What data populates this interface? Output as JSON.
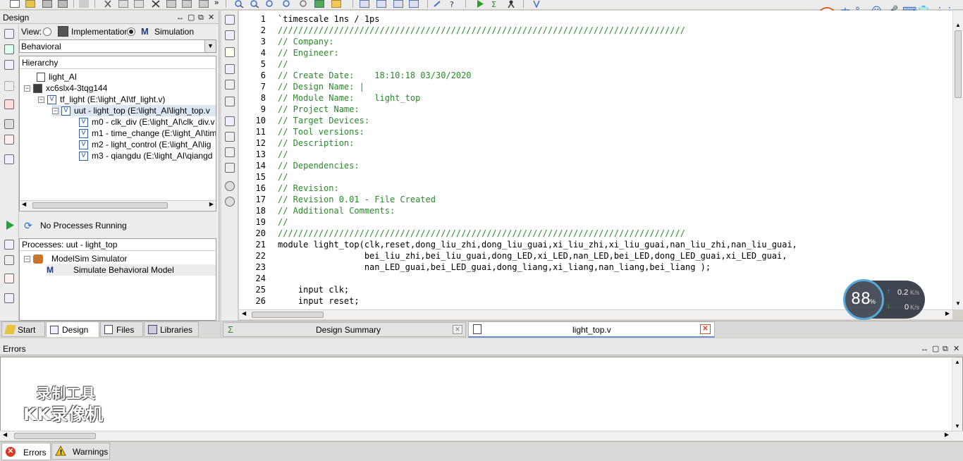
{
  "design_panel": {
    "title": "Design",
    "view_label": "View:",
    "view_options": [
      "Implementation",
      "Simulation"
    ],
    "view_selected": "Simulation",
    "behavior_select": "Behavioral",
    "hierarchy_title": "Hierarchy",
    "hierarchy": [
      {
        "label": "light_AI",
        "icon": "document-icon",
        "indent": 0
      },
      {
        "label": "xc6slx4-3tqg144",
        "icon": "chip-icon",
        "indent": 0
      },
      {
        "label": "tf_light (E:\\light_AI\\tf_light.v)",
        "icon": "verilog-icon",
        "indent": 1
      },
      {
        "label": "uut - light_top (E:\\light_AI\\light_top.v",
        "icon": "verilog-icon",
        "indent": 2
      },
      {
        "label": "m0 - clk_div (E:\\light_AI\\clk_div.v",
        "icon": "verilog-icon",
        "indent": 3
      },
      {
        "label": "m1 - time_change (E:\\light_AI\\tim",
        "icon": "verilog-icon",
        "indent": 3
      },
      {
        "label": "m2 - light_control (E:\\light_AI\\lig",
        "icon": "verilog-icon",
        "indent": 3
      },
      {
        "label": "m3 - qiangdu (E:\\light_AI\\qiangd",
        "icon": "verilog-icon",
        "indent": 3
      }
    ],
    "process_status": "No Processes Running",
    "processes_title": "Processes: uut - light_top",
    "processes": [
      {
        "label": "ModelSim Simulator"
      },
      {
        "label": "Simulate Behavioral Model"
      }
    ],
    "bottom_tabs": [
      "Start",
      "Design",
      "Files",
      "Libraries"
    ],
    "active_bottom_tab": "Design"
  },
  "editor": {
    "tabs": [
      {
        "label": "Design Summary"
      },
      {
        "label": "light_top.v"
      }
    ],
    "active_tab": "light_top.v",
    "lines": [
      {
        "n": "1",
        "text": "`timescale 1ns / 1ps",
        "color": "black"
      },
      {
        "n": "2",
        "text": "////////////////////////////////////////////////////////////////////////////////",
        "color": "green"
      },
      {
        "n": "3",
        "text": "// Company:",
        "color": "green"
      },
      {
        "n": "4",
        "text": "// Engineer:",
        "color": "green"
      },
      {
        "n": "5",
        "text": "//",
        "color": "green"
      },
      {
        "n": "6",
        "text": "// Create Date:    18:10:18 03/30/2020",
        "color": "green"
      },
      {
        "n": "7",
        "text": "// Design Name: |",
        "color": "green"
      },
      {
        "n": "8",
        "text": "// Module Name:    light_top",
        "color": "green"
      },
      {
        "n": "9",
        "text": "// Project Name:",
        "color": "green"
      },
      {
        "n": "10",
        "text": "// Target Devices:",
        "color": "green"
      },
      {
        "n": "11",
        "text": "// Tool versions:",
        "color": "green"
      },
      {
        "n": "12",
        "text": "// Description:",
        "color": "green"
      },
      {
        "n": "13",
        "text": "//",
        "color": "green"
      },
      {
        "n": "14",
        "text": "// Dependencies:",
        "color": "green"
      },
      {
        "n": "15",
        "text": "//",
        "color": "green"
      },
      {
        "n": "16",
        "text": "// Revision:",
        "color": "green"
      },
      {
        "n": "17",
        "text": "// Revision 0.01 - File Created",
        "color": "green"
      },
      {
        "n": "18",
        "text": "// Additional Comments:",
        "color": "green"
      },
      {
        "n": "19",
        "text": "//",
        "color": "green"
      },
      {
        "n": "20",
        "text": "////////////////////////////////////////////////////////////////////////////////",
        "color": "green"
      },
      {
        "n": "21",
        "text": "module light_top(clk,reset,dong_liu_zhi,dong_liu_guai,xi_liu_zhi,xi_liu_guai,nan_liu_zhi,nan_liu_guai,",
        "color": "black"
      },
      {
        "n": "22",
        "text": "                 bei_liu_zhi,bei_liu_guai,dong_LED,xi_LED,nan_LED,bei_LED,dong_LED_guai,xi_LED_guai,",
        "color": "black"
      },
      {
        "n": "23",
        "text": "                 nan_LED_guai,bei_LED_guai,dong_liang,xi_liang,nan_liang,bei_liang );",
        "color": "black"
      },
      {
        "n": "24",
        "text": "",
        "color": "black"
      },
      {
        "n": "25",
        "text": "    input clk;",
        "color": "black"
      },
      {
        "n": "26",
        "text": "    input reset;",
        "color": "black"
      }
    ]
  },
  "errors_panel": {
    "title": "Errors",
    "tabs": [
      "Errors",
      "Warnings"
    ]
  },
  "overlay": {
    "speed_percent": "88",
    "percent_sign": "%",
    "upload": "0.2",
    "upload_unit": "K/s",
    "download": "0",
    "download_unit": "K/s",
    "ime": [
      "中",
      "°,",
      "☺",
      "🎤",
      "⌨",
      "👕",
      "⋮⋮"
    ],
    "watermark_line1": "录制工具",
    "watermark_line2": "KK录像机"
  },
  "colors": {
    "comment": "#2a8a2a",
    "code": "#000000",
    "close_red": "#e0411f",
    "accent": "#2f5fa8"
  }
}
